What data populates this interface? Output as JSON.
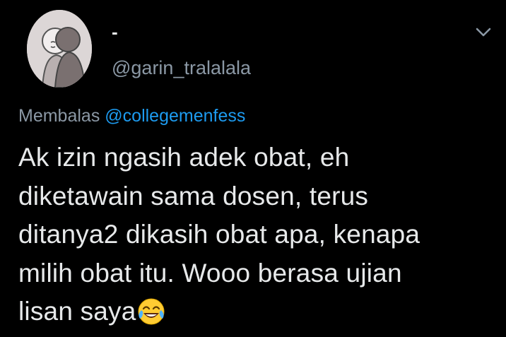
{
  "tweet": {
    "author": {
      "display_name": "-",
      "handle": "@garin_tralalala",
      "avatar_icon": "user-avatar"
    },
    "menu_icon": "chevron-down-icon",
    "reply": {
      "prefix": "Membalas",
      "mention": "@collegemenfess"
    },
    "text_lines": [
      "Ak izin ngasih adek obat, eh",
      "diketawain sama dosen, terus",
      "ditanya2 dikasih obat apa, kenapa",
      "milih obat itu. Wooo berasa ujian",
      "lisan saya"
    ],
    "trailing_emoji": "face-with-tears-of-joy-icon"
  },
  "colors": {
    "background": "#000000",
    "text": "#e7e9ea",
    "secondary": "#8b98a5",
    "accent": "#1d9bf0"
  }
}
